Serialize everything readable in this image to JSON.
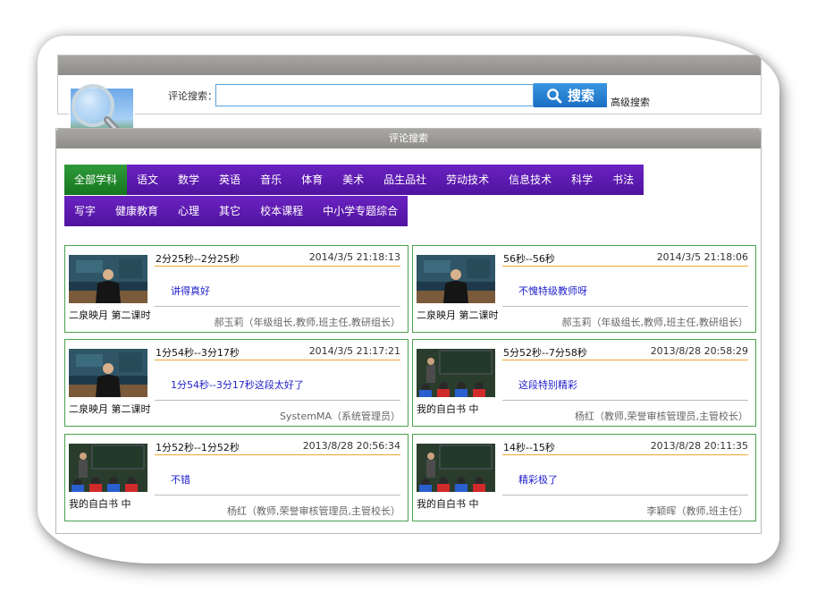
{
  "search": {
    "label": "评论搜索：",
    "placeholder": "",
    "button_label": "搜索",
    "advanced_link": "高级搜索"
  },
  "panel": {
    "title": "评论搜索"
  },
  "tabs_row1": [
    "全部学科",
    "语文",
    "数学",
    "英语",
    "音乐",
    "体育",
    "美术",
    "品生品社",
    "劳动技术",
    "信息技术",
    "科学",
    "书法"
  ],
  "tabs_row2": [
    "写字",
    "健康教育",
    "心理",
    "其它",
    "校本课程",
    "中小学专题综合"
  ],
  "active_tab": "全部学科",
  "cards": [
    {
      "video_title": "二泉映月 第二课时",
      "time_range": "2分25秒--2分25秒",
      "date": "2014/3/5 21:18:13",
      "comment": "讲得真好",
      "author": "郝玉莉（年级组长,教师,班主任,教研组长）",
      "thumb": "teacher"
    },
    {
      "video_title": "二泉映月 第二课时",
      "time_range": "56秒--56秒",
      "date": "2014/3/5 21:18:06",
      "comment": "不愧特级教师呀",
      "author": "郝玉莉（年级组长,教师,班主任,教研组长）",
      "thumb": "teacher"
    },
    {
      "video_title": "二泉映月 第二课时",
      "time_range": "1分54秒--3分17秒",
      "date": "2014/3/5 21:17:21",
      "comment": "1分54秒--3分17秒这段太好了",
      "author": "SystemMA（系统管理员）",
      "thumb": "teacher"
    },
    {
      "video_title": "我的自白书 中",
      "time_range": "5分52秒--7分58秒",
      "date": "2013/8/28 20:58:29",
      "comment": "这段特别精彩",
      "author": "杨红（教师,荣誉审核管理员,主管校长）",
      "thumb": "classroom"
    },
    {
      "video_title": "我的自白书 中",
      "time_range": "1分52秒--1分52秒",
      "date": "2013/8/28 20:56:34",
      "comment": "不错",
      "author": "杨红（教师,荣誉审核管理员,主管校长）",
      "thumb": "classroom"
    },
    {
      "video_title": "我的自白书 中",
      "time_range": "14秒--15秒",
      "date": "2013/8/28 20:11:35",
      "comment": "精彩极了",
      "author": "李颖晖（教师,班主任）",
      "thumb": "classroom"
    }
  ],
  "colors": {
    "tab_purple": "#5a1aa8",
    "tab_active_green": "#16761f",
    "card_border": "#49a14e",
    "comment_blue": "#2222cc",
    "search_button": "#1a6fc4"
  }
}
